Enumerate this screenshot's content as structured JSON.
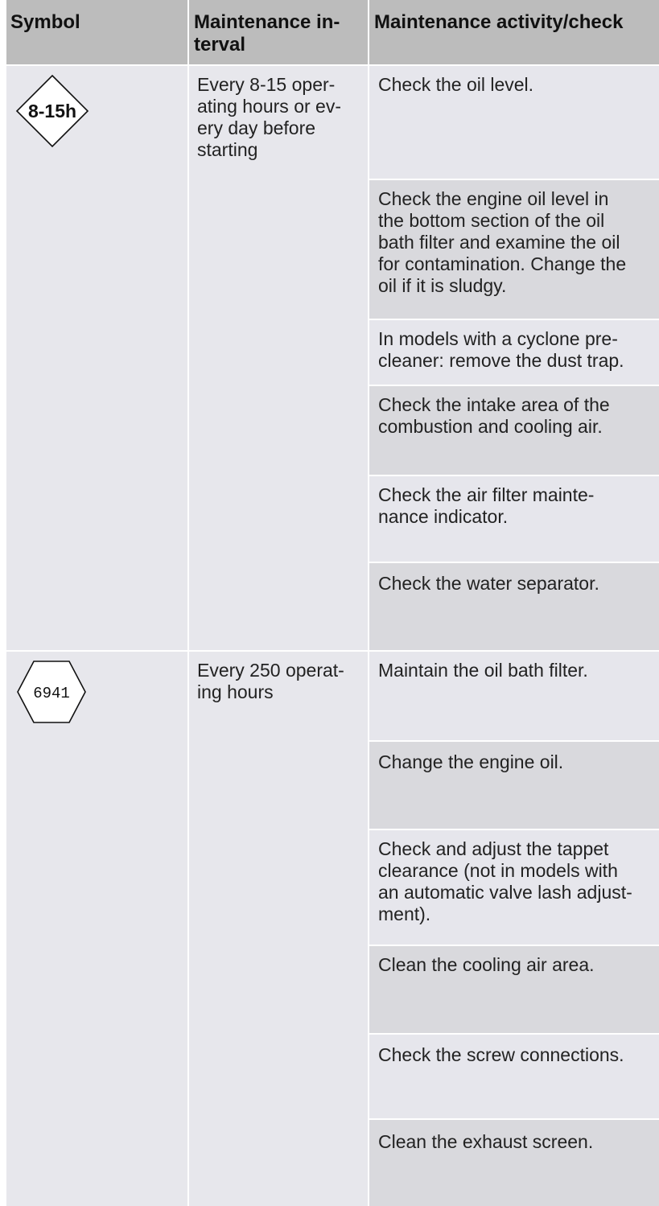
{
  "headers": {
    "symbol": "Symbol",
    "interval": "Maintenance in-\nterval",
    "activity": "Maintenance activity/check"
  },
  "groups": [
    {
      "symbol_icon": "diamond-interval-icon",
      "symbol_text": "8-15h",
      "interval": "Every 8-15 oper-\nating hours or ev-\nery day before\nstarting",
      "activities": [
        "Check the oil level.",
        "Check the engine oil level in\nthe bottom section of the oil\nbath filter and examine the oil\nfor contamination. Change the\noil if it is sludgy.",
        "In models with a cyclone pre-\ncleaner: remove the dust trap.",
        "Check the intake area of the\ncombustion and cooling air.",
        "Check the air filter mainte-\nnance indicator.",
        "Check the water separator."
      ]
    },
    {
      "symbol_icon": "hexagon-interval-icon",
      "symbol_text": "6941",
      "interval": "Every 250 operat-\ning hours",
      "activities": [
        "Maintain the oil bath filter.",
        "Change the engine oil.",
        "Check and adjust the tappet\nclearance (not in models with\nan automatic valve lash adjust-\nment).",
        "Clean the cooling air area.",
        "Check the screw connections.",
        "Clean the exhaust screen."
      ]
    }
  ],
  "colors": {
    "header_bg": "#bcbcbc",
    "row_light": "#e6e6ec",
    "row_dark": "#d9d9dd",
    "divider": "#ffffff"
  }
}
